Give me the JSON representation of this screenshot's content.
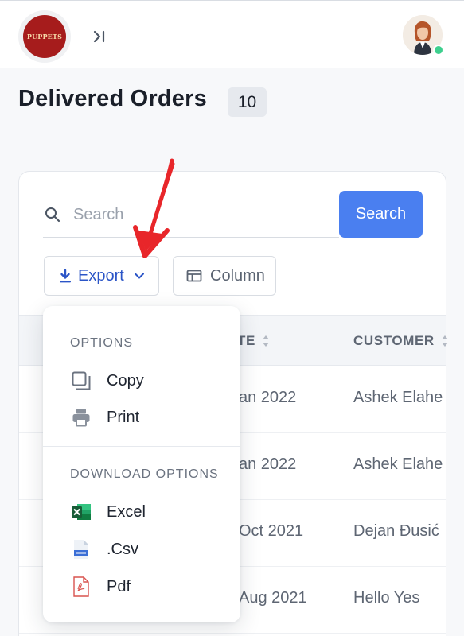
{
  "header": {
    "logo_text": "PUPPETS",
    "collapse_icon": "chevron-right-bar-icon",
    "avatar_status_color": "#3ecf8e"
  },
  "page": {
    "title": "Delivered Orders",
    "count": "10"
  },
  "search": {
    "placeholder": "Search",
    "value": "",
    "button_label": "Search"
  },
  "toolbar": {
    "export_label": "Export",
    "column_label": "Column"
  },
  "table": {
    "columns": [
      "TE",
      "CUSTOMER"
    ],
    "rows": [
      {
        "date": "an 2022",
        "customer": "Ashek Elahe"
      },
      {
        "date": "an 2022",
        "customer": "Ashek Elahe"
      },
      {
        "date": "Oct 2021",
        "customer": "Dejan Đusić"
      },
      {
        "date": "Aug 2021",
        "customer": "Hello Yes"
      }
    ]
  },
  "export_menu": {
    "options_title": "OPTIONS",
    "options": [
      {
        "label": "Copy",
        "icon": "copy-icon"
      },
      {
        "label": "Print",
        "icon": "printer-icon"
      }
    ],
    "download_title": "DOWNLOAD OPTIONS",
    "downloads": [
      {
        "label": "Excel",
        "icon": "excel-icon"
      },
      {
        "label": ".Csv",
        "icon": "csv-icon"
      },
      {
        "label": "Pdf",
        "icon": "pdf-icon"
      }
    ]
  },
  "colors": {
    "accent": "#4a7ff0",
    "export_text": "#2b55c7",
    "annotation": "#e8262a",
    "logo_bg": "#a61c1c"
  }
}
